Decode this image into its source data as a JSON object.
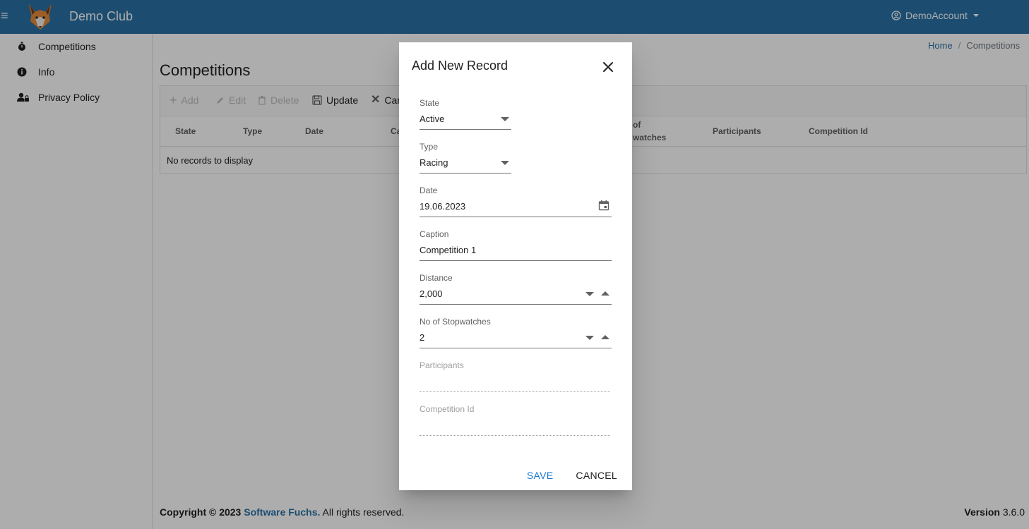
{
  "app": {
    "title": "Demo Club",
    "account": "DemoAccount"
  },
  "sidebar": {
    "items": [
      {
        "label": "Competitions",
        "icon": "stopwatch-icon"
      },
      {
        "label": "Info",
        "icon": "info-icon"
      },
      {
        "label": "Privacy Policy",
        "icon": "user-lock-icon"
      }
    ]
  },
  "breadcrumb": {
    "home": "Home",
    "current": "Competitions"
  },
  "page": {
    "title": "Competitions"
  },
  "toolbar": {
    "add": "Add",
    "edit": "Edit",
    "delete": "Delete",
    "update": "Update",
    "cancel": "Car"
  },
  "grid": {
    "columns": [
      "State",
      "Type",
      "Date",
      "Ca",
      "of",
      "Participants",
      "Competition Id"
    ],
    "columns_wrap_second": "watches",
    "empty_message": "No records to display"
  },
  "footer": {
    "copyright": "Copyright © 2023",
    "brand": "Software Fuchs.",
    "rights": "All rights reserved.",
    "version_label": "Version",
    "version": "3.6.0"
  },
  "dialog": {
    "title": "Add New Record",
    "fields": {
      "state": {
        "label": "State",
        "value": "Active"
      },
      "type": {
        "label": "Type",
        "value": "Racing"
      },
      "date": {
        "label": "Date",
        "value": "19.06.2023"
      },
      "caption": {
        "label": "Caption",
        "value": "Competition 1"
      },
      "distance": {
        "label": "Distance",
        "value": "2,000"
      },
      "stopwatches": {
        "label": "No of Stopwatches",
        "value": "2"
      },
      "participants": {
        "label": "Participants",
        "value": ""
      },
      "competition_id": {
        "label": "Competition Id",
        "value": ""
      }
    },
    "save": "SAVE",
    "cancel": "CANCEL"
  },
  "colors": {
    "primary": "#2a72a7",
    "button_blue": "#1976d2",
    "overlay": "rgba(0,0,0,0.32)"
  }
}
